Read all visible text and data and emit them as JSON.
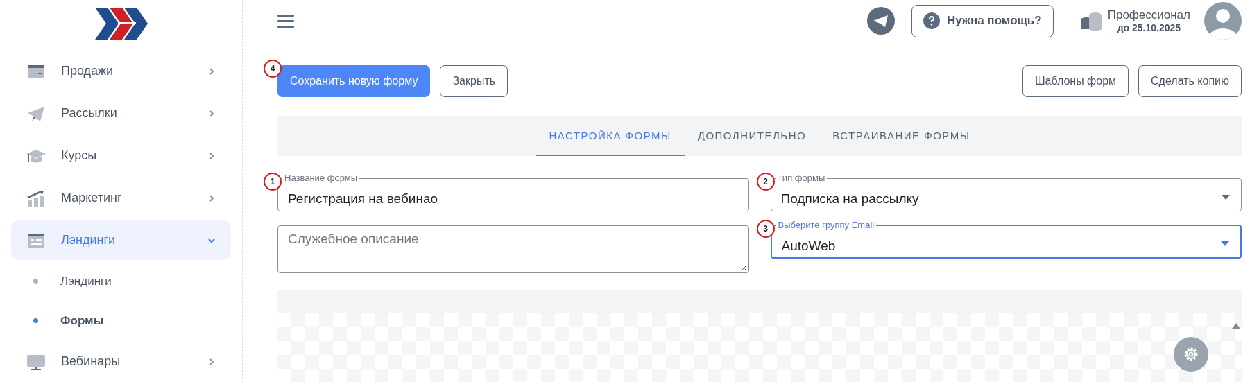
{
  "sidebar": {
    "items": [
      {
        "label": "Продажи",
        "expanded": false,
        "selected": false
      },
      {
        "label": "Рассылки",
        "expanded": false,
        "selected": false
      },
      {
        "label": "Курсы",
        "expanded": false,
        "selected": false
      },
      {
        "label": "Маркетинг",
        "expanded": false,
        "selected": false
      },
      {
        "label": "Лэндинги",
        "expanded": true,
        "selected": true,
        "children": [
          {
            "label": "Лэндинги",
            "selected": false
          },
          {
            "label": "Формы",
            "selected": true
          }
        ]
      },
      {
        "label": "Вебинары",
        "expanded": false,
        "selected": false
      }
    ]
  },
  "header": {
    "help_button": "Нужна помощь?",
    "plan": {
      "name": "Профессионал",
      "until": "до 25.10.2025"
    }
  },
  "actions": [
    {
      "label": "Сохранить новую форму",
      "kind": "primary",
      "badge": "4"
    },
    {
      "label": "Закрыть",
      "kind": "outline"
    }
  ],
  "right_actions": [
    {
      "label": "Шаблоны форм",
      "kind": "outline"
    },
    {
      "label": "Сделать копию",
      "kind": "outline"
    }
  ],
  "tabs": [
    {
      "label": "НАСТРОЙКА ФОРМЫ",
      "selected": true
    },
    {
      "label": "ДОПОЛНИТЕЛЬНО",
      "selected": false
    },
    {
      "label": "ВСТРАИВАНИЕ ФОРМЫ",
      "selected": false
    }
  ],
  "fields": [
    {
      "kind": "input",
      "label": "Название формы",
      "value": "Регистрация на вебинао",
      "badge": "1",
      "focused": false
    },
    {
      "kind": "select",
      "label": "Тип формы",
      "value": "Подписка на рассылку",
      "badge": "2",
      "focused": false
    },
    {
      "kind": "textarea",
      "placeholder": "Служебное описание",
      "focused": false
    },
    {
      "kind": "select",
      "label": "Выберите группу Email",
      "value": "AutoWeb",
      "badge": "3",
      "focused": true
    }
  ]
}
